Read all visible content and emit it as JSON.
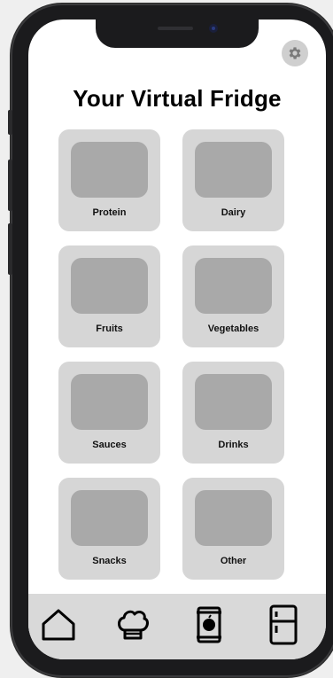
{
  "title": "Your Virtual Fridge",
  "categories": [
    {
      "label": "Protein"
    },
    {
      "label": "Dairy"
    },
    {
      "label": "Fruits"
    },
    {
      "label": "Vegetables"
    },
    {
      "label": "Sauces"
    },
    {
      "label": "Drinks"
    },
    {
      "label": "Snacks"
    },
    {
      "label": "Other"
    }
  ],
  "tabs": [
    {
      "icon": "home-icon"
    },
    {
      "icon": "chef-hat-icon"
    },
    {
      "icon": "canned-food-icon"
    },
    {
      "icon": "fridge-icon"
    }
  ],
  "settings": {
    "icon": "gear-icon"
  },
  "colors": {
    "tile_bg": "#d6d6d6",
    "tile_image": "#a9a9a9",
    "tab_bar_bg": "#d9d9d9",
    "device_frame": "#1b1b1d"
  }
}
